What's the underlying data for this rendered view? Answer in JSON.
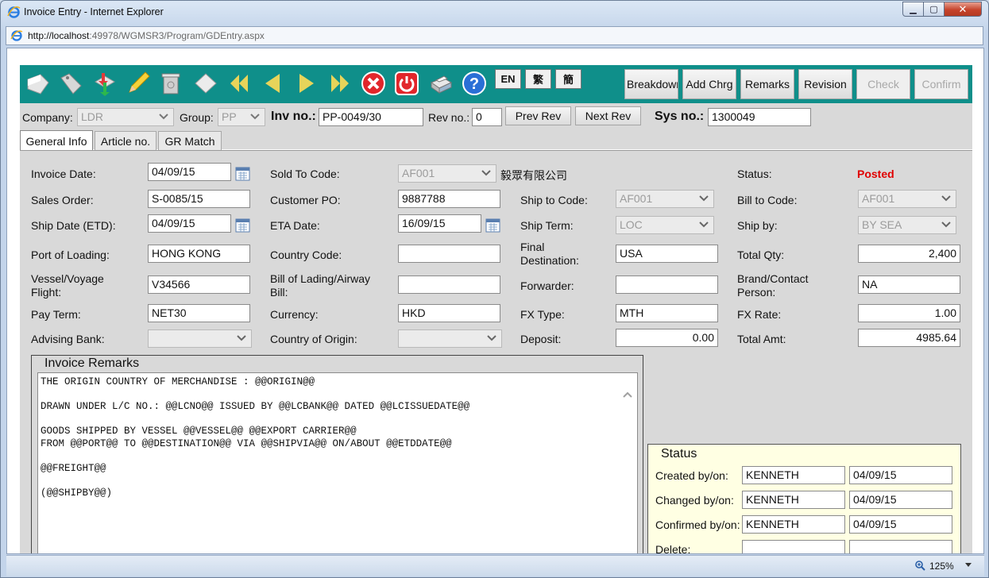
{
  "window": {
    "title": "Invoice Entry - Internet Explorer",
    "url_host": "http://localhost",
    "url_rest": ":49978/WGMSR3/Program/GDEntry.aspx",
    "zoom": "125%"
  },
  "toolbar": {
    "icons": [
      "new-document-icon",
      "tag-icon",
      "copy-arrows-icon",
      "pencil-edit-icon",
      "trash-icon",
      "eraser-icon",
      "first-record-icon",
      "previous-record-icon",
      "next-record-icon",
      "last-record-icon",
      "cancel-icon",
      "power-icon",
      "print-icon",
      "help-icon"
    ],
    "lang": {
      "en": "EN",
      "trad": "繁",
      "simp": "簡"
    },
    "actions": {
      "breakdown": "Breakdown",
      "add_chrg": "Add Chrg",
      "remarks": "Remarks",
      "revision": "Revision",
      "check": "Check",
      "confirm": "Confirm"
    }
  },
  "header": {
    "company_label": "Company:",
    "company_value": "LDR",
    "group_label": "Group:",
    "group_value": "PP",
    "inv_label": "Inv no.:",
    "inv_value": "PP-0049/30",
    "rev_label": "Rev no.:",
    "rev_value": "0",
    "prev_rev": "Prev Rev",
    "next_rev": "Next Rev",
    "sys_label": "Sys no.:",
    "sys_value": "1300049"
  },
  "tabs": [
    "General Info",
    "Article no.",
    "GR Match"
  ],
  "form": {
    "invoice_date_label": "Invoice Date:",
    "invoice_date": "04/09/15",
    "sold_to_label": "Sold To Code:",
    "sold_to": "AF001",
    "sold_to_name": "毅眾有限公司",
    "status_label": "Status:",
    "status": "Posted",
    "sales_order_label": "Sales Order:",
    "sales_order": "S-0085/15",
    "customer_po_label": "Customer PO:",
    "customer_po": "9887788",
    "ship_to_label": "Ship to Code:",
    "ship_to": "AF001",
    "bill_to_label": "Bill to Code:",
    "bill_to": "AF001",
    "ship_date_label": "Ship Date (ETD):",
    "ship_date": "04/09/15",
    "eta_label": "ETA Date:",
    "eta": "16/09/15",
    "ship_term_label": "Ship Term:",
    "ship_term": "LOC",
    "ship_by_label": "Ship by:",
    "ship_by": "BY SEA",
    "port_label": "Port of Loading:",
    "port": "HONG KONG",
    "country_code_label": "Country Code:",
    "country_code": "",
    "final_dest_label": "Final Destination:",
    "final_dest": "USA",
    "total_qty_label": "Total Qty:",
    "total_qty": "2,400",
    "vessel_label": "Vessel/Voyage Flight:",
    "vessel": "V34566",
    "bill_lading_label": "Bill of Lading/Airway Bill:",
    "bill_lading": "",
    "forwarder_label": "Forwarder:",
    "forwarder": "",
    "brand_label": "Brand/Contact Person:",
    "brand": "NA",
    "pay_term_label": "Pay Term:",
    "pay_term": "NET30",
    "currency_label": "Currency:",
    "currency": "HKD",
    "fx_type_label": "FX Type:",
    "fx_type": "MTH",
    "fx_rate_label": "FX Rate:",
    "fx_rate": "1.00",
    "advising_bank_label": "Advising Bank:",
    "advising_bank": "",
    "country_origin_label": "Country of Origin:",
    "country_origin": "",
    "deposit_label": "Deposit:",
    "deposit": "0.00",
    "total_amt_label": "Total Amt:",
    "total_amt": "4985.64"
  },
  "remarks": {
    "title": "Invoice Remarks",
    "text": "THE ORIGIN COUNTRY OF MERCHANDISE : @@ORIGIN@@\n\nDRAWN UNDER L/C NO.: @@LCNO@@ ISSUED BY @@LCBANK@@ DATED @@LCISSUEDATE@@\n\nGOODS SHIPPED BY VESSEL @@VESSEL@@ @@EXPORT CARRIER@@\nFROM @@PORT@@ TO @@DESTINATION@@ VIA @@SHIPVIA@@ ON/ABOUT @@ETDDATE@@\n\n@@FREIGHT@@\n\n(@@SHIPBY@@)"
  },
  "status_box": {
    "title": "Status",
    "created_label": "Created by/on:",
    "created_by": "KENNETH",
    "created_on": "04/09/15",
    "changed_label": "Changed by/on:",
    "changed_by": "KENNETH",
    "changed_on": "04/09/15",
    "confirmed_label": "Confirmed by/on:",
    "confirmed_by": "KENNETH",
    "confirmed_on": "04/09/15",
    "delete_label": "Delete:",
    "delete_by": "",
    "delete_on": ""
  },
  "colors": {
    "toolbar": "#0f8f8a",
    "status_posted": "#e00000",
    "panel": "#d9d9d9"
  }
}
